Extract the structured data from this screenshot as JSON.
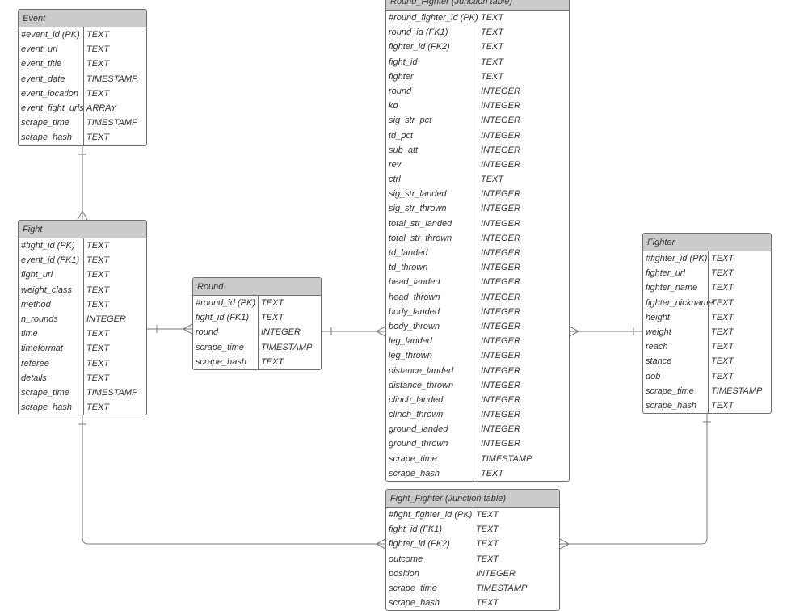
{
  "entities": {
    "event": {
      "title": "Event",
      "rows": [
        [
          "#event_id (PK)",
          "TEXT"
        ],
        [
          "event_url",
          "TEXT"
        ],
        [
          "event_title",
          "TEXT"
        ],
        [
          "event_date",
          "TIMESTAMP"
        ],
        [
          "event_location",
          "TEXT"
        ],
        [
          "event_fight_urls",
          "ARRAY"
        ],
        [
          "scrape_time",
          "TIMESTAMP"
        ],
        [
          "scrape_hash",
          "TEXT"
        ]
      ]
    },
    "fight": {
      "title": "Fight",
      "rows": [
        [
          "#fight_id (PK)",
          "TEXT"
        ],
        [
          "event_id (FK1)",
          "TEXT"
        ],
        [
          "fight_url",
          "TEXT"
        ],
        [
          "weight_class",
          "TEXT"
        ],
        [
          "method",
          "TEXT"
        ],
        [
          "n_rounds",
          "INTEGER"
        ],
        [
          "time",
          "TEXT"
        ],
        [
          "timeformat",
          "TEXT"
        ],
        [
          "referee",
          "TEXT"
        ],
        [
          "details",
          "TEXT"
        ],
        [
          "scrape_time",
          "TIMESTAMP"
        ],
        [
          "scrape_hash",
          "TEXT"
        ]
      ]
    },
    "round": {
      "title": "Round",
      "rows": [
        [
          "#round_id (PK)",
          "TEXT"
        ],
        [
          "fight_id (FK1)",
          "TEXT"
        ],
        [
          "round",
          "INTEGER"
        ],
        [
          "scrape_time",
          "TIMESTAMP"
        ],
        [
          "scrape_hash",
          "TEXT"
        ]
      ]
    },
    "round_fighter": {
      "title": "Round_Fighter (Junction table)",
      "rows": [
        [
          "#round_fighter_id (PK)",
          "TEXT"
        ],
        [
          "round_id (FK1)",
          "TEXT"
        ],
        [
          "fighter_id (FK2)",
          "TEXT"
        ],
        [
          "fight_id",
          "TEXT"
        ],
        [
          "fighter",
          "TEXT"
        ],
        [
          "round",
          "INTEGER"
        ],
        [
          "kd",
          "INTEGER"
        ],
        [
          "sig_str_pct",
          "INTEGER"
        ],
        [
          "td_pct",
          "INTEGER"
        ],
        [
          "sub_att",
          "INTEGER"
        ],
        [
          "rev",
          "INTEGER"
        ],
        [
          "ctrl",
          "TEXT"
        ],
        [
          "sig_str_landed",
          "INTEGER"
        ],
        [
          "sig_str_thrown",
          "INTEGER"
        ],
        [
          "total_str_landed",
          "INTEGER"
        ],
        [
          "total_str_thrown",
          "INTEGER"
        ],
        [
          "td_landed",
          "INTEGER"
        ],
        [
          "td_thrown",
          "INTEGER"
        ],
        [
          "head_landed",
          "INTEGER"
        ],
        [
          "head_thrown",
          "INTEGER"
        ],
        [
          "body_landed",
          "INTEGER"
        ],
        [
          "body_thrown",
          "INTEGER"
        ],
        [
          "leg_landed",
          "INTEGER"
        ],
        [
          "leg_thrown",
          "INTEGER"
        ],
        [
          "distance_landed",
          "INTEGER"
        ],
        [
          "distance_thrown",
          "INTEGER"
        ],
        [
          "clinch_landed",
          "INTEGER"
        ],
        [
          "clinch_thrown",
          "INTEGER"
        ],
        [
          "ground_landed",
          "INTEGER"
        ],
        [
          "ground_thrown",
          "INTEGER"
        ],
        [
          "scrape_time",
          "TIMESTAMP"
        ],
        [
          "scrape_hash",
          "TEXT"
        ]
      ]
    },
    "fighter": {
      "title": "Fighter",
      "rows": [
        [
          "#fighter_id (PK)",
          "TEXT"
        ],
        [
          "fighter_url",
          "TEXT"
        ],
        [
          "fighter_name",
          "TEXT"
        ],
        [
          "fighter_nickname",
          "TEXT"
        ],
        [
          "height",
          "TEXT"
        ],
        [
          "weight",
          "TEXT"
        ],
        [
          "reach",
          "TEXT"
        ],
        [
          "stance",
          "TEXT"
        ],
        [
          "dob",
          "TEXT"
        ],
        [
          "scrape_time",
          "TIMESTAMP"
        ],
        [
          "scrape_hash",
          "TEXT"
        ]
      ]
    },
    "fight_fighter": {
      "title": "Fight_Fighter (Junction table)",
      "rows": [
        [
          "#fight_fighter_id (PK)",
          "TEXT"
        ],
        [
          "fight_id (FK1)",
          "TEXT"
        ],
        [
          "fighter_id (FK2)",
          "TEXT"
        ],
        [
          "outcome",
          "TEXT"
        ],
        [
          "position",
          "INTEGER"
        ],
        [
          "scrape_time",
          "TIMESTAMP"
        ],
        [
          "scrape_hash",
          "TEXT"
        ]
      ]
    }
  },
  "colors": {
    "header_bg": "#cbcbcb",
    "border": "#6f6f6f",
    "text": "#333333"
  }
}
